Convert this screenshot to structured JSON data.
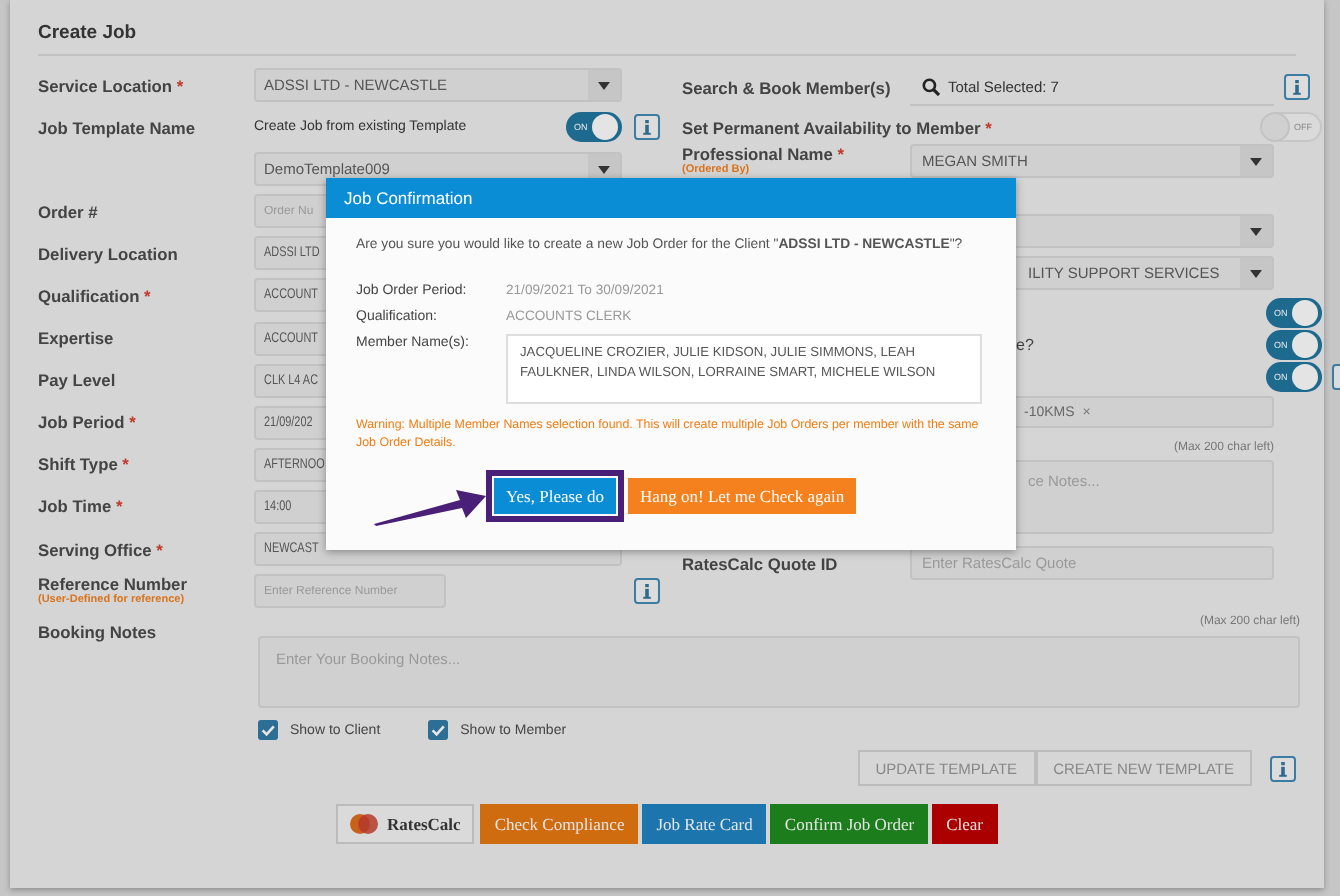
{
  "page_title": "Create Job",
  "left_rows": [
    {
      "label": "Service Location",
      "required_mark": "*",
      "kind": "select",
      "value": "ADSSI LTD - NEWCASTLE"
    },
    {
      "label": "Job Template Name",
      "kind": "switch",
      "text": "Create Job from existing Template",
      "toggle": {
        "on": true,
        "text": "ON"
      },
      "info": true
    },
    {
      "kind": "select",
      "value": "DemoTemplate009"
    },
    {
      "label": "Order #",
      "kind": "input",
      "placeholder": "Order Nu"
    },
    {
      "label": "Delivery Location",
      "kind": "text",
      "value": "ADSSI LTD"
    },
    {
      "label": "Qualification",
      "required_mark": "*",
      "kind": "text",
      "value": "ACCOUNT"
    },
    {
      "label": "Expertise",
      "kind": "text",
      "value": "ACCOUNT"
    },
    {
      "label": "Pay Level",
      "kind": "text",
      "value": "CLK L4 AC"
    },
    {
      "label": "Job Period",
      "required_mark": "*",
      "kind": "text",
      "value": "21/09/202"
    },
    {
      "label": "Shift Type",
      "required_mark": "*",
      "kind": "text",
      "value": "AFTERNOO"
    },
    {
      "label": "Job Time",
      "required_mark": "*",
      "kind": "text",
      "value": "14:00"
    },
    {
      "label": "Serving Office",
      "required_mark": "*",
      "kind": "text",
      "value": "NEWCAST"
    },
    {
      "label": "Reference Number",
      "note": "(User-Defined for reference)",
      "kind": "input",
      "placeholder": "Enter Reference Number",
      "info": true
    }
  ],
  "right_rows": [
    {
      "label": "Search & Book Member(s)",
      "kind": "search",
      "value": "Total Selected: 7",
      "info": true
    },
    {
      "label": "Set Permanent Availability to Member",
      "required_mark": "*",
      "kind": "toggle",
      "toggle": {
        "on": false,
        "text": "OFF"
      }
    },
    {
      "label": "Professional Name",
      "required_mark": "*",
      "note": "(Ordered By)",
      "kind": "select",
      "value": "MEGAN SMITH"
    },
    {
      "kind": "select"
    },
    {
      "kind": "select",
      "value": "ILITY SUPPORT SERVICES"
    },
    {
      "kind": "toggle",
      "toggle": {
        "on": true,
        "text": "ON"
      }
    },
    {
      "label": "e?",
      "kind": "toggle",
      "toggle": {
        "on": true,
        "text": "ON"
      }
    },
    {
      "kind": "toggle",
      "toggle": {
        "on": true,
        "text": "ON"
      },
      "info": true
    },
    {
      "kind": "tags",
      "tags": [
        {
          "text": "-10KMS",
          "remove": "×"
        }
      ]
    },
    {
      "kind": "counter",
      "text": "(Max 200 char left)"
    },
    {
      "kind": "textarea",
      "placeholder": "ce Notes..."
    },
    {
      "label": "RatesCalc Quote ID",
      "kind": "input",
      "placeholder": "Enter RatesCalc Quote"
    }
  ],
  "booking_notes": {
    "label": "Booking Notes",
    "counter": "(Max 200 char left)",
    "placeholder": "Enter Your Booking Notes...",
    "checkboxes": [
      {
        "label": "Show to Client",
        "checked": true
      },
      {
        "label": "Show to Member",
        "checked": true
      }
    ]
  },
  "template_buttons": [
    "UPDATE TEMPLATE",
    "CREATE NEW TEMPLATE"
  ],
  "template_info": true,
  "actions": [
    {
      "label": "RatesCalc",
      "kind": "logo"
    },
    {
      "label": "Check Compliance",
      "kind": "orange"
    },
    {
      "label": "Job Rate Card",
      "kind": "blue"
    },
    {
      "label": "Confirm Job Order",
      "kind": "green"
    },
    {
      "label": "Clear",
      "kind": "red"
    }
  ],
  "dialog": {
    "title": "Job Confirmation",
    "question": "Are you sure you would like to create a new Job Order for the Client \"**ADSSI LTD - NEWCASTLE**\"?",
    "details": [
      {
        "label": "Job Order Period:",
        "value": "21/09/2021 To 30/09/2021",
        "kind": "text"
      },
      {
        "label": "Qualification:",
        "value": "ACCOUNTS CLERK",
        "kind": "text"
      },
      {
        "label": "Member Name(s):",
        "value": "JACQUELINE CROZIER, JULIE KIDSON, JULIE SIMMONS, LEAH FAULKNER, LINDA WILSON, LORRAINE SMART, MICHELE WILSON",
        "kind": "box"
      }
    ],
    "warning": "Warning: Multiple Member Names selection found. This will create multiple Job Orders per member with the same Job Order Details.",
    "buttons": [
      {
        "label": "Yes, Please do",
        "kind": "primary",
        "highlighted": true
      },
      {
        "label": "Hang on! Let me Check again",
        "kind": "secondary",
        "highlighted": false
      }
    ]
  }
}
